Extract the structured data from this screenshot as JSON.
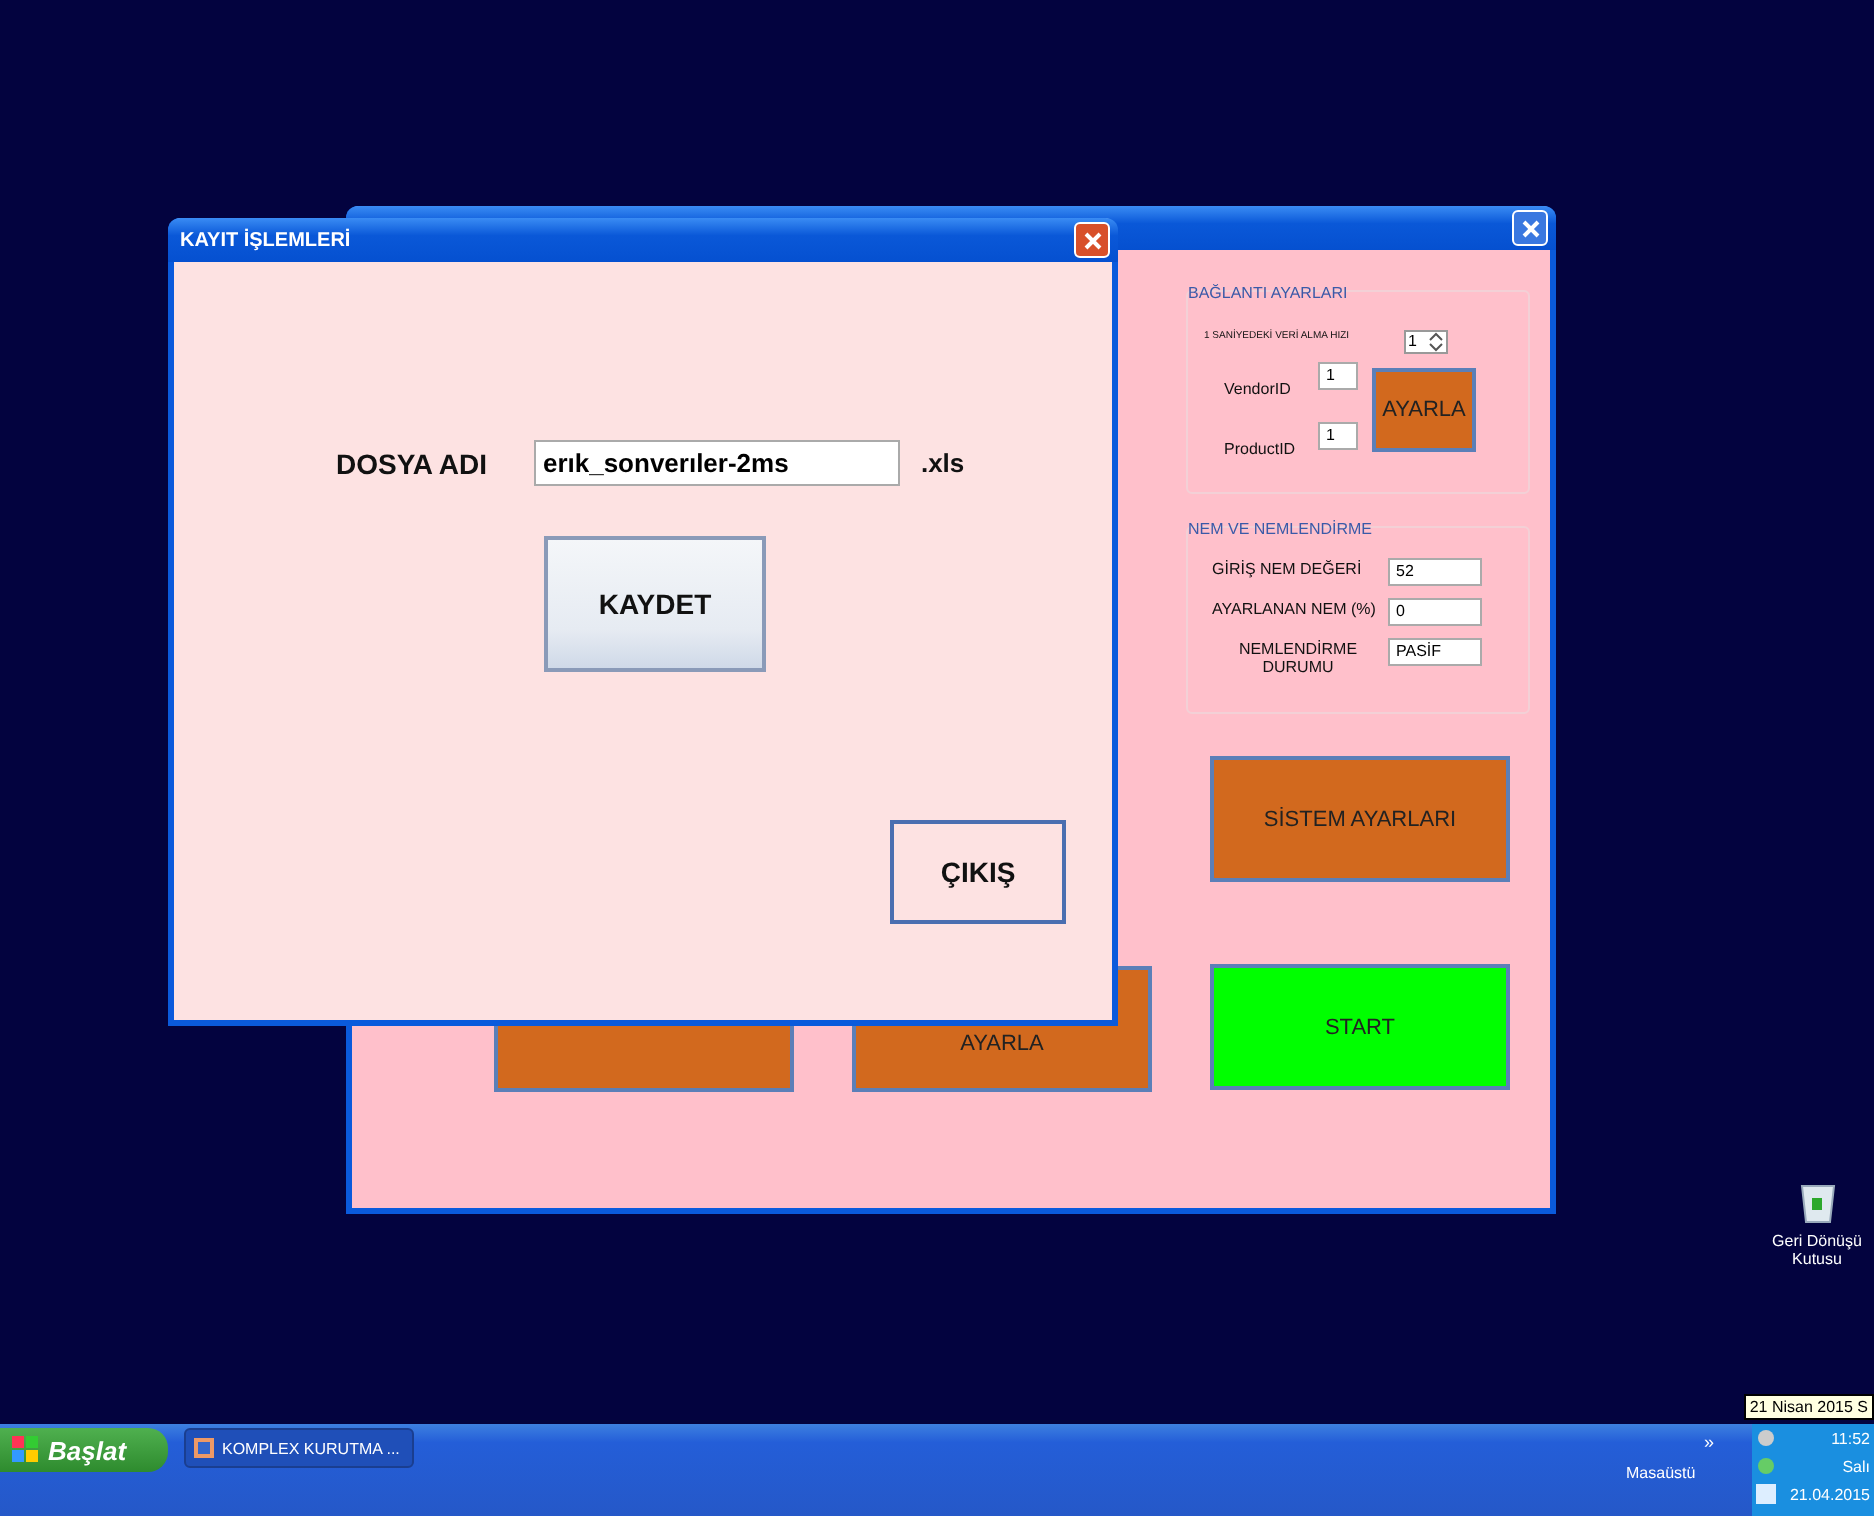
{
  "main_window": {
    "connection": {
      "title": "BAĞLANTI AYARLARI",
      "rate_label": "1 SANİYEDEKİ VERİ ALMA HIZI",
      "rate_value": "1",
      "vendor_label": "VendorID",
      "vendor_value": "1",
      "product_label": "ProductID",
      "product_value": "1",
      "apply_button": "AYARLA"
    },
    "humidity": {
      "title": "NEM VE NEMLENDİRME",
      "rows": [
        {
          "label": "GİRİŞ NEM DEĞERİ",
          "value": "52"
        },
        {
          "label": "AYARLANAN NEM (%)",
          "value": "0"
        },
        {
          "label": "NEMLENDİRME DURUMU",
          "value": "PASİF"
        }
      ]
    },
    "buttons": [
      {
        "label": "SİSTEM AYARLARI",
        "color": "#d2691e"
      },
      {
        "color": "#d2691e"
      },
      {
        "label": "AYARLA",
        "color": "#d2691e"
      },
      {
        "label": "START",
        "color": "#00ff00"
      }
    ]
  },
  "dialog": {
    "title": "KAYIT İŞLEMLERİ",
    "file_label": "DOSYA ADI",
    "file_value": "erık_sonverıler-2ms",
    "extension": ".xls",
    "save_button": "KAYDET",
    "exit_button": "ÇIKIŞ"
  },
  "desktop_icon": {
    "label": "Geri Dönüşü Kutusu"
  },
  "taskbar": {
    "start": "Başlat",
    "task": "KOMPLEX KURUTMA ...",
    "desktop_label": "Masaüstü",
    "chevron": "»",
    "time": "11:52",
    "day": "Salı",
    "date": "21.04.2015",
    "tooltip": "21 Nisan 2015 S"
  }
}
